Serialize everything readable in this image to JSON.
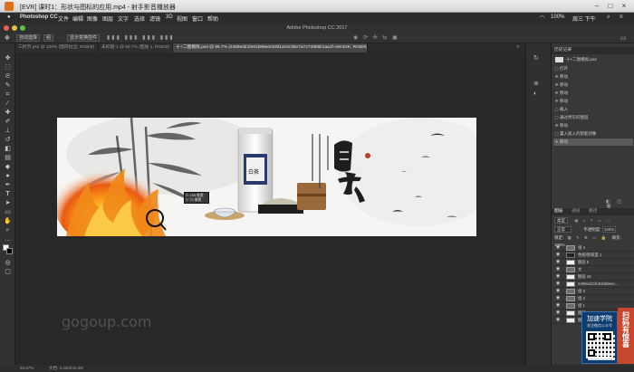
{
  "player": {
    "title": "[EVR] 课时1：形状与图标的应用.mp4 - 射手影音播放器",
    "icon": "player-icon",
    "controls": [
      "minimize-icon",
      "maximize-icon",
      "close-icon"
    ]
  },
  "menubar": {
    "apple": "",
    "app": "Photoshop CC",
    "items": [
      "文件",
      "编辑",
      "图像",
      "图层",
      "文字",
      "选择",
      "滤镜",
      "3D",
      "视图",
      "窗口",
      "帮助"
    ],
    "status": [
      "S",
      "100%",
      "周三 下午"
    ]
  },
  "ps_window_title": "Adobe Photoshop CC 2017",
  "options_bar": {
    "auto_select": "自动选择",
    "layer_dropdown": "组",
    "show_transform": "显示变换控件"
  },
  "tabs": [
    {
      "label": "三折页.psd @ 100% (图形拉出, RGB/8)"
    },
    {
      "label": "未标题-1 @ 66.7% (图层 1, RGB/8)"
    },
    {
      "label": "十+二图模拟.psd @ 66.7% (2469ed21fe81b69eec53d1ac0c36e7a72749b5b1aa1f-n8m0xK, RGB/8)",
      "active": true
    }
  ],
  "canvas": {
    "calligraphy_title": "白茶",
    "vertical_text_1": "一年茶  三年药  七年宝",
    "vertical_text_2": "古道茶香 深蕴茗韵",
    "tooltip_line1": "X: 155 像素",
    "tooltip_line2": "Y: 72 像素",
    "tin_label": "白茶"
  },
  "watermark": "gogoup.com",
  "status_bar": {
    "zoom": "66.67%",
    "doc": "文档: 3.22M/34.3M"
  },
  "history": {
    "panel_label": "历史记录",
    "snapshot": "十+二图模拟.psd",
    "rows": [
      "打开",
      "移动",
      "移动",
      "移动",
      "移动",
      "载入",
      "通过拷贝的图层",
      "移动",
      "置入嵌入的智能对象",
      "移动"
    ]
  },
  "layers": {
    "tabs": [
      "图层",
      "通道",
      "路径"
    ],
    "kind": "类型",
    "blend": "正常",
    "opacity_label": "不透明度:",
    "opacity": "100%",
    "lock_label": "锁定:",
    "fill_label": "填充:",
    "fill": "100%",
    "rows": [
      {
        "name": "组 4",
        "group": true
      },
      {
        "name": "色相/饱和度 1"
      },
      {
        "name": "图层 5"
      },
      {
        "name": "文",
        "group": true
      },
      {
        "name": "图层 16"
      },
      {
        "name": "2469ed21fe81b69eec..."
      },
      {
        "name": "组 3",
        "group": true
      },
      {
        "name": "组 2",
        "group": true
      },
      {
        "name": "组 1",
        "group": true
      },
      {
        "name": "图层 1"
      },
      {
        "name": "图层 3"
      }
    ]
  },
  "promo": {
    "title": "加速学院",
    "sub": "关注微信公众号",
    "side": "扫码有惊喜"
  }
}
